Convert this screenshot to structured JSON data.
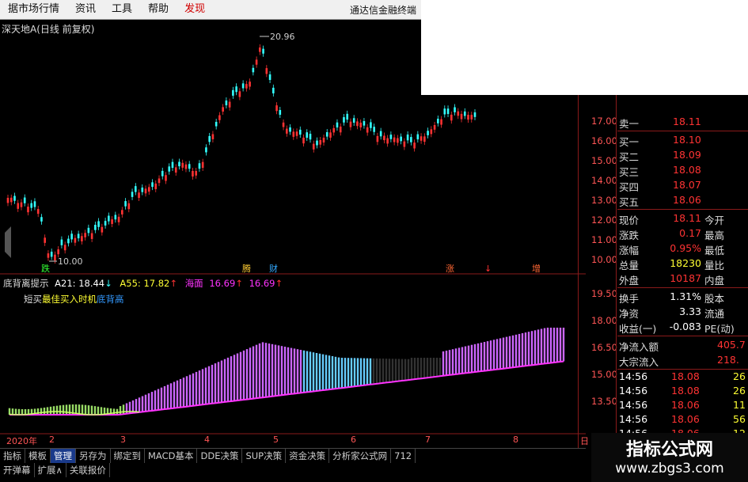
{
  "menu": {
    "items": [
      "据市场行情",
      "资讯",
      "工具",
      "帮助",
      "发现"
    ],
    "brand": "通达信金融终端"
  },
  "chart": {
    "title": "深天地A(日线 前复权)",
    "high_label": "20.96",
    "low_label": "10.00",
    "marker_labels": [
      "跌",
      "腾",
      "财",
      "涨",
      "↓",
      "增"
    ],
    "price_ticks": [
      "17.00",
      "16.00",
      "15.00",
      "14.00",
      "13.00",
      "12.00",
      "11.00",
      "10.00"
    ]
  },
  "indicator": {
    "name": "底背离提示",
    "a21_label": "A21:",
    "a21_value": "18.44",
    "a21_arrow": "↓",
    "a55_label": "A55:",
    "a55_value": "17.82",
    "a55_arrow": "↑",
    "sea_label": "海面",
    "sea_value1": "16.69",
    "sea_arrow1": "↑",
    "sea_value2": "16.69",
    "sea_arrow2": "↑",
    "legend_short": "短买",
    "legend_best": "最佳买入时机",
    "legend_bottom": "底背高",
    "ticks": [
      "19.50",
      "18.00",
      "16.50",
      "15.00",
      "13.50"
    ]
  },
  "quote": {
    "sell1": {
      "label": "卖一",
      "value": "18.11"
    },
    "buys": [
      {
        "label": "买一",
        "value": "18.10"
      },
      {
        "label": "买二",
        "value": "18.09"
      },
      {
        "label": "买三",
        "value": "18.08"
      },
      {
        "label": "买四",
        "value": "18.07"
      },
      {
        "label": "买五",
        "value": "18.06"
      }
    ],
    "stats": [
      {
        "label": "现价",
        "value": "18.11",
        "label2": "今开"
      },
      {
        "label": "涨跌",
        "value": "0.17",
        "label2": "最高"
      },
      {
        "label": "涨幅",
        "value": "0.95%",
        "label2": "最低"
      },
      {
        "label": "总量",
        "value": "18230",
        "label2": "量比"
      },
      {
        "label": "外盘",
        "value": "10187",
        "label2": "内盘"
      },
      {
        "label": "换手",
        "value": "1.31%",
        "label2": "股本"
      },
      {
        "label": "净资",
        "value": "3.33",
        "label2": "流通"
      },
      {
        "label": "收益(一)",
        "value": "-0.083",
        "label2": "PE(动)"
      }
    ],
    "flows": [
      {
        "label": "净流入额",
        "value": "405.7"
      },
      {
        "label": "大宗流入",
        "value": "218."
      }
    ],
    "trades": [
      {
        "time": "14:56",
        "price": "18.08",
        "vol": "26"
      },
      {
        "time": "14:56",
        "price": "18.08",
        "vol": "26"
      },
      {
        "time": "14:56",
        "price": "18.06",
        "vol": "11"
      },
      {
        "time": "14:56",
        "price": "18.06",
        "vol": "56"
      },
      {
        "time": "14:56",
        "price": "18.06",
        "vol": "12"
      }
    ]
  },
  "dates": [
    "2020年",
    "2",
    "3",
    "4",
    "5",
    "6",
    "7",
    "8",
    "日"
  ],
  "tabs": [
    "指标",
    "模板",
    "管理",
    "另存为",
    "绑定到",
    "MACD基本",
    "DDE决策",
    "SUP决策",
    "资金决策",
    "分析家公式网",
    "712"
  ],
  "active_tab": "管理",
  "tabs2": [
    "开弹幕",
    "扩展∧",
    "关联报价"
  ],
  "watermark": {
    "line1": "指标公式网",
    "line2": "www.zbgs3.com"
  },
  "colors": {
    "up": "#ff3333",
    "down": "#33ffff",
    "purple": "#ff33ff",
    "green": "#99ff66",
    "yellow": "#ffff33"
  }
}
